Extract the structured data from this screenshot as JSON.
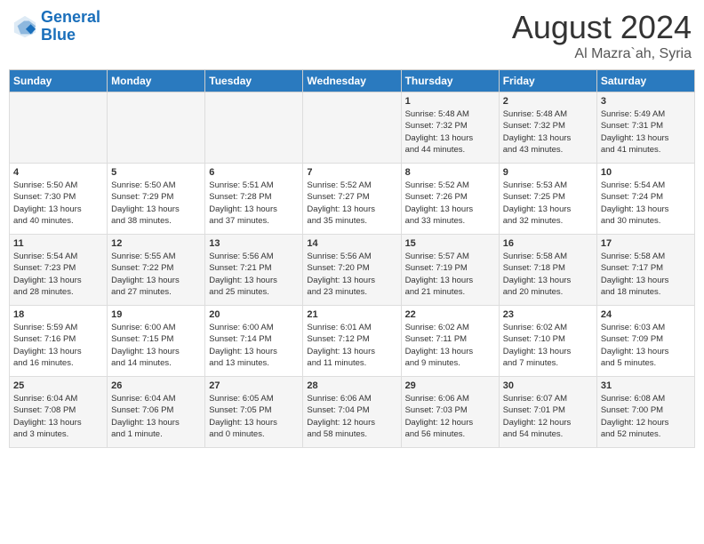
{
  "header": {
    "logo_line1": "General",
    "logo_line2": "Blue",
    "month": "August 2024",
    "location": "Al Mazra`ah, Syria"
  },
  "days_of_week": [
    "Sunday",
    "Monday",
    "Tuesday",
    "Wednesday",
    "Thursday",
    "Friday",
    "Saturday"
  ],
  "weeks": [
    [
      {
        "day": "",
        "info": ""
      },
      {
        "day": "",
        "info": ""
      },
      {
        "day": "",
        "info": ""
      },
      {
        "day": "",
        "info": ""
      },
      {
        "day": "1",
        "info": "Sunrise: 5:48 AM\nSunset: 7:32 PM\nDaylight: 13 hours\nand 44 minutes."
      },
      {
        "day": "2",
        "info": "Sunrise: 5:48 AM\nSunset: 7:32 PM\nDaylight: 13 hours\nand 43 minutes."
      },
      {
        "day": "3",
        "info": "Sunrise: 5:49 AM\nSunset: 7:31 PM\nDaylight: 13 hours\nand 41 minutes."
      }
    ],
    [
      {
        "day": "4",
        "info": "Sunrise: 5:50 AM\nSunset: 7:30 PM\nDaylight: 13 hours\nand 40 minutes."
      },
      {
        "day": "5",
        "info": "Sunrise: 5:50 AM\nSunset: 7:29 PM\nDaylight: 13 hours\nand 38 minutes."
      },
      {
        "day": "6",
        "info": "Sunrise: 5:51 AM\nSunset: 7:28 PM\nDaylight: 13 hours\nand 37 minutes."
      },
      {
        "day": "7",
        "info": "Sunrise: 5:52 AM\nSunset: 7:27 PM\nDaylight: 13 hours\nand 35 minutes."
      },
      {
        "day": "8",
        "info": "Sunrise: 5:52 AM\nSunset: 7:26 PM\nDaylight: 13 hours\nand 33 minutes."
      },
      {
        "day": "9",
        "info": "Sunrise: 5:53 AM\nSunset: 7:25 PM\nDaylight: 13 hours\nand 32 minutes."
      },
      {
        "day": "10",
        "info": "Sunrise: 5:54 AM\nSunset: 7:24 PM\nDaylight: 13 hours\nand 30 minutes."
      }
    ],
    [
      {
        "day": "11",
        "info": "Sunrise: 5:54 AM\nSunset: 7:23 PM\nDaylight: 13 hours\nand 28 minutes."
      },
      {
        "day": "12",
        "info": "Sunrise: 5:55 AM\nSunset: 7:22 PM\nDaylight: 13 hours\nand 27 minutes."
      },
      {
        "day": "13",
        "info": "Sunrise: 5:56 AM\nSunset: 7:21 PM\nDaylight: 13 hours\nand 25 minutes."
      },
      {
        "day": "14",
        "info": "Sunrise: 5:56 AM\nSunset: 7:20 PM\nDaylight: 13 hours\nand 23 minutes."
      },
      {
        "day": "15",
        "info": "Sunrise: 5:57 AM\nSunset: 7:19 PM\nDaylight: 13 hours\nand 21 minutes."
      },
      {
        "day": "16",
        "info": "Sunrise: 5:58 AM\nSunset: 7:18 PM\nDaylight: 13 hours\nand 20 minutes."
      },
      {
        "day": "17",
        "info": "Sunrise: 5:58 AM\nSunset: 7:17 PM\nDaylight: 13 hours\nand 18 minutes."
      }
    ],
    [
      {
        "day": "18",
        "info": "Sunrise: 5:59 AM\nSunset: 7:16 PM\nDaylight: 13 hours\nand 16 minutes."
      },
      {
        "day": "19",
        "info": "Sunrise: 6:00 AM\nSunset: 7:15 PM\nDaylight: 13 hours\nand 14 minutes."
      },
      {
        "day": "20",
        "info": "Sunrise: 6:00 AM\nSunset: 7:14 PM\nDaylight: 13 hours\nand 13 minutes."
      },
      {
        "day": "21",
        "info": "Sunrise: 6:01 AM\nSunset: 7:12 PM\nDaylight: 13 hours\nand 11 minutes."
      },
      {
        "day": "22",
        "info": "Sunrise: 6:02 AM\nSunset: 7:11 PM\nDaylight: 13 hours\nand 9 minutes."
      },
      {
        "day": "23",
        "info": "Sunrise: 6:02 AM\nSunset: 7:10 PM\nDaylight: 13 hours\nand 7 minutes."
      },
      {
        "day": "24",
        "info": "Sunrise: 6:03 AM\nSunset: 7:09 PM\nDaylight: 13 hours\nand 5 minutes."
      }
    ],
    [
      {
        "day": "25",
        "info": "Sunrise: 6:04 AM\nSunset: 7:08 PM\nDaylight: 13 hours\nand 3 minutes."
      },
      {
        "day": "26",
        "info": "Sunrise: 6:04 AM\nSunset: 7:06 PM\nDaylight: 13 hours\nand 1 minute."
      },
      {
        "day": "27",
        "info": "Sunrise: 6:05 AM\nSunset: 7:05 PM\nDaylight: 13 hours\nand 0 minutes."
      },
      {
        "day": "28",
        "info": "Sunrise: 6:06 AM\nSunset: 7:04 PM\nDaylight: 12 hours\nand 58 minutes."
      },
      {
        "day": "29",
        "info": "Sunrise: 6:06 AM\nSunset: 7:03 PM\nDaylight: 12 hours\nand 56 minutes."
      },
      {
        "day": "30",
        "info": "Sunrise: 6:07 AM\nSunset: 7:01 PM\nDaylight: 12 hours\nand 54 minutes."
      },
      {
        "day": "31",
        "info": "Sunrise: 6:08 AM\nSunset: 7:00 PM\nDaylight: 12 hours\nand 52 minutes."
      }
    ]
  ]
}
